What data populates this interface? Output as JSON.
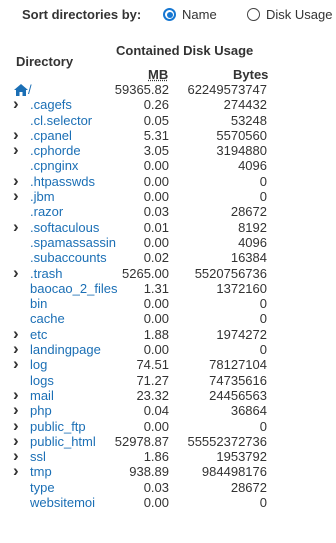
{
  "sort": {
    "label": "Sort directories by:",
    "options": [
      {
        "label": "Name",
        "checked": true
      },
      {
        "label": "Disk Usage",
        "checked": false
      }
    ]
  },
  "headers": {
    "directory": "Directory",
    "contained": "Contained Disk Usage",
    "mb": "MB",
    "bytes": "Bytes"
  },
  "colors": {
    "link": "#1b6fb5",
    "radio_accent": "#1677d2",
    "text": "#333333"
  },
  "rows": [
    {
      "name": "/",
      "mb": "59365.82",
      "bytes": "62249573747",
      "expandable": false,
      "home": true
    },
    {
      "name": ".cagefs",
      "mb": "0.26",
      "bytes": "274432",
      "expandable": true
    },
    {
      "name": ".cl.selector",
      "mb": "0.05",
      "bytes": "53248",
      "expandable": false
    },
    {
      "name": ".cpanel",
      "mb": "5.31",
      "bytes": "5570560",
      "expandable": true
    },
    {
      "name": ".cphorde",
      "mb": "3.05",
      "bytes": "3194880",
      "expandable": true
    },
    {
      "name": ".cpnginx",
      "mb": "0.00",
      "bytes": "4096",
      "expandable": false
    },
    {
      "name": ".htpasswds",
      "mb": "0.00",
      "bytes": "0",
      "expandable": true
    },
    {
      "name": ".jbm",
      "mb": "0.00",
      "bytes": "0",
      "expandable": true
    },
    {
      "name": ".razor",
      "mb": "0.03",
      "bytes": "28672",
      "expandable": false
    },
    {
      "name": ".softaculous",
      "mb": "0.01",
      "bytes": "8192",
      "expandable": true
    },
    {
      "name": ".spamassassin",
      "mb": "0.00",
      "bytes": "4096",
      "expandable": false
    },
    {
      "name": ".subaccounts",
      "mb": "0.02",
      "bytes": "16384",
      "expandable": false
    },
    {
      "name": ".trash",
      "mb": "5265.00",
      "bytes": "5520756736",
      "expandable": true
    },
    {
      "name": "baocao_2_files",
      "mb": "1.31",
      "bytes": "1372160",
      "expandable": false
    },
    {
      "name": "bin",
      "mb": "0.00",
      "bytes": "0",
      "expandable": false
    },
    {
      "name": "cache",
      "mb": "0.00",
      "bytes": "0",
      "expandable": false
    },
    {
      "name": "etc",
      "mb": "1.88",
      "bytes": "1974272",
      "expandable": true
    },
    {
      "name": "landingpage",
      "mb": "0.00",
      "bytes": "0",
      "expandable": true
    },
    {
      "name": "log",
      "mb": "74.51",
      "bytes": "78127104",
      "expandable": true
    },
    {
      "name": "logs",
      "mb": "71.27",
      "bytes": "74735616",
      "expandable": false
    },
    {
      "name": "mail",
      "mb": "23.32",
      "bytes": "24456563",
      "expandable": true
    },
    {
      "name": "php",
      "mb": "0.04",
      "bytes": "36864",
      "expandable": true
    },
    {
      "name": "public_ftp",
      "mb": "0.00",
      "bytes": "0",
      "expandable": true
    },
    {
      "name": "public_html",
      "mb": "52978.87",
      "bytes": "55552372736",
      "expandable": true
    },
    {
      "name": "ssl",
      "mb": "1.86",
      "bytes": "1953792",
      "expandable": true
    },
    {
      "name": "tmp",
      "mb": "938.89",
      "bytes": "984498176",
      "expandable": true
    },
    {
      "name": "type",
      "mb": "0.03",
      "bytes": "28672",
      "expandable": false
    },
    {
      "name": "websitemoi",
      "mb": "0.00",
      "bytes": "0",
      "expandable": false
    }
  ]
}
